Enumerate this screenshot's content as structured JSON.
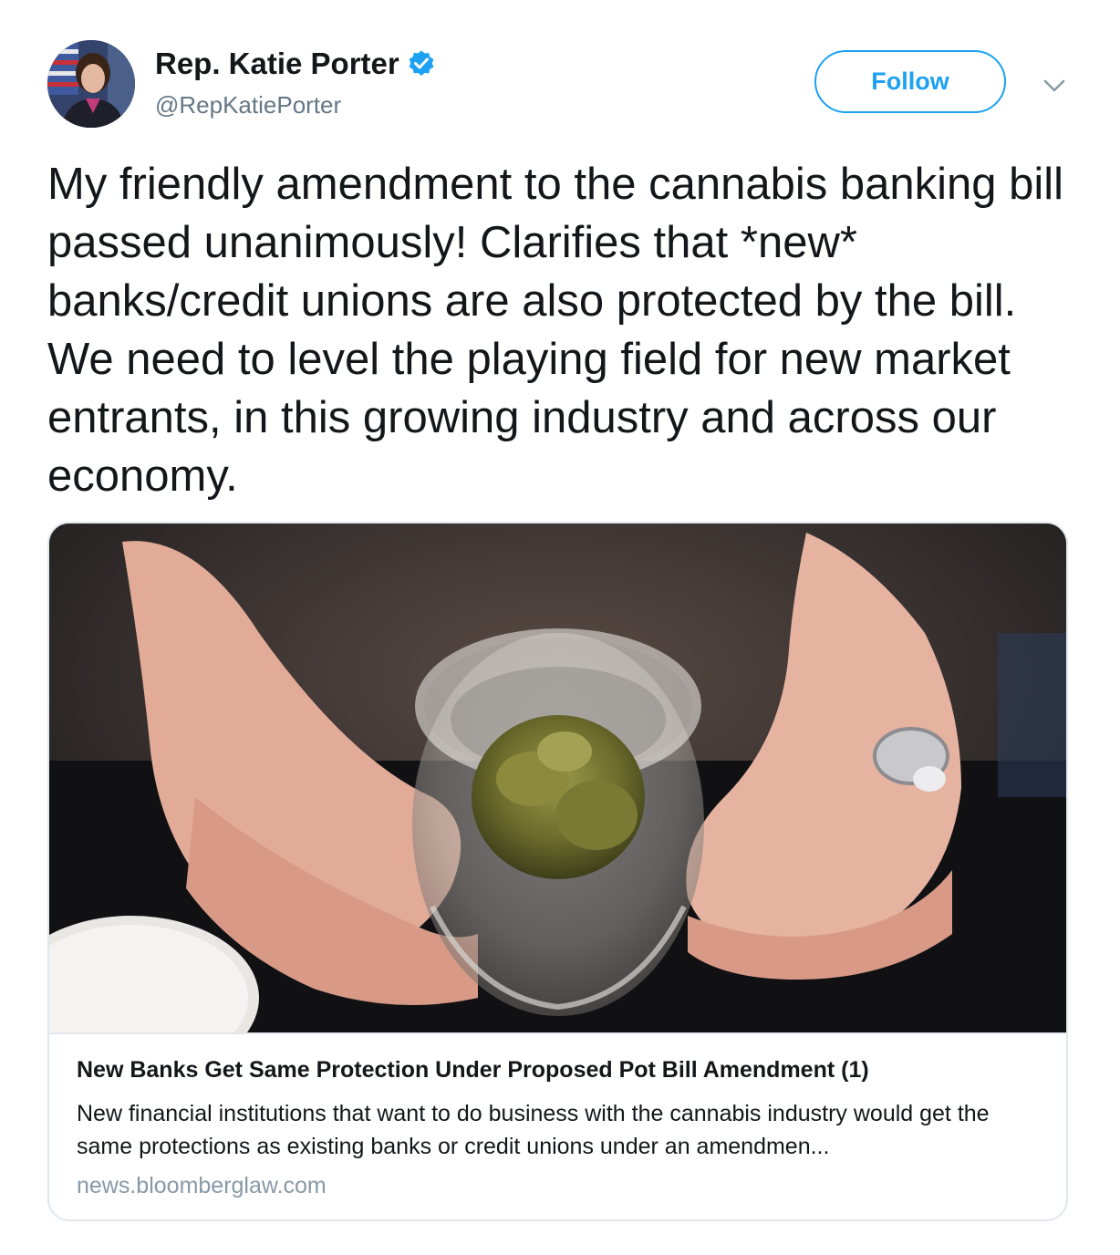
{
  "author": {
    "display_name": "Rep. Katie Porter",
    "handle": "@RepKatiePorter",
    "avatar_icon": "profile-photo",
    "verified_icon": "verified-badge-icon"
  },
  "actions": {
    "follow_label": "Follow",
    "menu_icon": "chevron-down-icon"
  },
  "tweet": {
    "text": "My friendly amendment to the cannabis banking bill passed unanimously! Clarifies that *new* banks/credit unions are also protected by the bill. We need to level the playing field for new market entrants, in this growing industry and across our economy."
  },
  "link_card": {
    "image_icon": "cannabis-jar-photo",
    "title": "New Banks Get Same Protection Under Proposed Pot Bill Amendment (1)",
    "description": "New financial institutions that want to do business with the cannabis industry would get the same protections as existing banks or credit unions under an amendmen...",
    "domain": "news.bloomberglaw.com"
  },
  "colors": {
    "accent": "#1da1f2",
    "text": "#14171a",
    "secondary_text": "#657786",
    "muted_text": "#8899a6",
    "border": "#e1e8ed"
  }
}
